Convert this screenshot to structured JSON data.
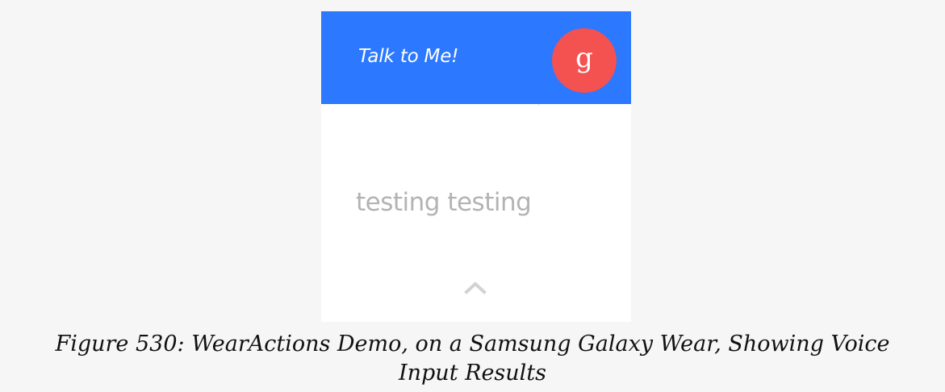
{
  "wear_app": {
    "header": {
      "title": "Talk to Me!",
      "voice_action_icon": "google-g-icon",
      "voice_action_letter": "g",
      "background_color": "#2c78ff",
      "button_color": "#f45151"
    },
    "result": {
      "text": "testing testing"
    },
    "controls": {
      "scroll_icon": "chevron-up-icon"
    }
  },
  "caption": {
    "text": "Figure 530: WearActions Demo, on a Samsung Galaxy Wear, Showing Voice Input Results"
  }
}
